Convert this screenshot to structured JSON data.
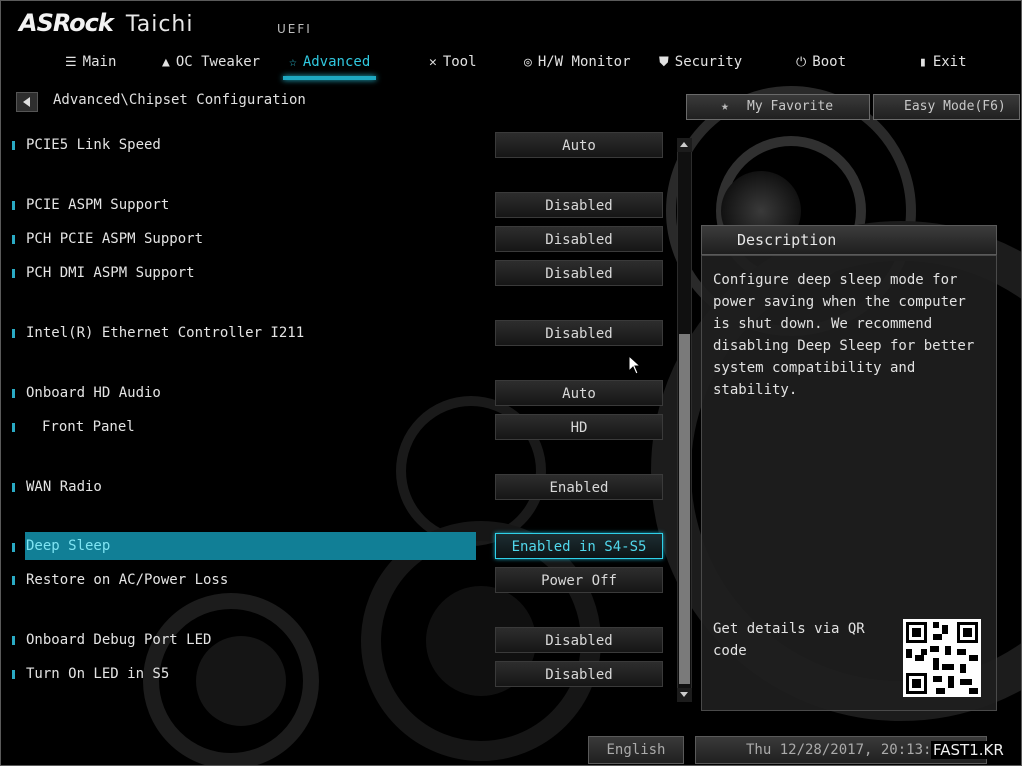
{
  "header": {
    "brand": "ASRock",
    "model": "Taichi",
    "firmware": "UEFI"
  },
  "nav": [
    {
      "label": "Main",
      "icon": "list-icon"
    },
    {
      "label": "OC Tweaker",
      "icon": "flame-icon"
    },
    {
      "label": "Advanced",
      "icon": "star-icon",
      "active": true
    },
    {
      "label": "Tool",
      "icon": "tools-icon"
    },
    {
      "label": "H/W Monitor",
      "icon": "monitor-icon"
    },
    {
      "label": "Security",
      "icon": "shield-icon"
    },
    {
      "label": "Boot",
      "icon": "power-icon"
    },
    {
      "label": "Exit",
      "icon": "exit-icon"
    }
  ],
  "breadcrumb": "Advanced\\Chipset Configuration",
  "favorites": {
    "my_favorite": "My Favorite",
    "easy_mode": "Easy Mode(F6)"
  },
  "settings": [
    {
      "label": "PCIE5 Link Speed",
      "value": "Auto"
    },
    {
      "label": "PCIE ASPM Support",
      "value": "Disabled"
    },
    {
      "label": "PCH PCIE ASPM Support",
      "value": "Disabled"
    },
    {
      "label": "PCH DMI ASPM Support",
      "value": "Disabled"
    },
    {
      "label": "Intel(R) Ethernet Controller I211",
      "value": "Disabled"
    },
    {
      "label": "Onboard HD Audio",
      "value": "Auto"
    },
    {
      "label": "Front Panel",
      "value": "HD"
    },
    {
      "label": "WAN Radio",
      "value": "Enabled"
    },
    {
      "label": "Deep Sleep",
      "value": "Enabled in S4-S5",
      "selected": true
    },
    {
      "label": "Restore on AC/Power Loss",
      "value": "Power Off"
    },
    {
      "label": "Onboard Debug Port LED",
      "value": "Disabled"
    },
    {
      "label": "Turn On LED in S5",
      "value": "Disabled"
    }
  ],
  "description": {
    "title": "Description",
    "text": "Configure deep sleep mode for power saving when the computer is shut down. We recommend disabling Deep Sleep for better system compatibility and stability.",
    "qr_text": "Get details via QR code"
  },
  "footer": {
    "language": "English",
    "datetime": "Thu 12/28/2017, 20:13:0"
  },
  "watermark": "FAST1.KR",
  "colors": {
    "accent": "#1ea8c2",
    "highlight_row": "#117f96",
    "background": "#000000"
  }
}
